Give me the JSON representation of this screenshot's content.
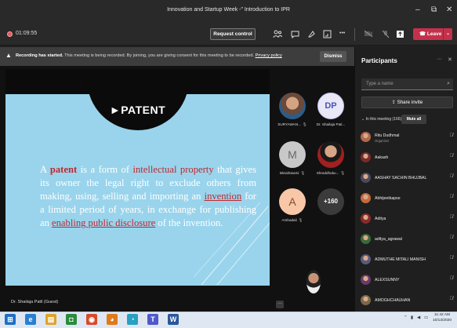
{
  "window": {
    "title": "Innovation and Startup Week -\" Introduction to IPR",
    "minimize_glyph": "–",
    "maximize_glyph": "⧉",
    "close_glyph": "✕"
  },
  "toolbar": {
    "timer": "01:09:55",
    "request_control_label": "Request control",
    "more_glyph": "•••",
    "leave_label": "Leave",
    "icons": [
      "people-icon",
      "chat-icon",
      "reactions-icon",
      "rooms-icon",
      "more-icon",
      "camera-icon",
      "mic-icon",
      "share-icon"
    ]
  },
  "banner": {
    "bold": "Recording has started.",
    "text": " This meeting is being recorded. By joining, you are giving consent for this meeting to be recorded.",
    "link": "Privacy policy",
    "dismiss_label": "Dismiss"
  },
  "slide": {
    "heading": "►PATENT",
    "body": {
      "p1": "A ",
      "patent": "patent",
      "p2": " is a form of ",
      "ip": "intellectual property",
      "p3": " that gives its owner the legal right to exclude others from making, using, selling and importing an ",
      "invention": "invention",
      "p4": " for a limited period of years, in exchange for publishing an ",
      "enabling": "enabling public disclosure",
      "p5": " of the invention."
    }
  },
  "presenter_label": "Dr. Shailaja Patil (Guest)",
  "tiles": [
    {
      "name": "SURYAWAN...",
      "initials": ""
    },
    {
      "name": "Dr. Shailaja Pati...",
      "initials": "DP"
    },
    {
      "name": "MinalSwami",
      "initials": "M"
    },
    {
      "name": "Shraddhaku...",
      "initials": ""
    },
    {
      "name": "Arshadali",
      "initials": "A"
    },
    {
      "name": "",
      "initials": "+160"
    }
  ],
  "panel": {
    "title": "Participants",
    "search_placeholder": "Type a name",
    "share_invite_label": "Share invite",
    "in_meeting_label": "In this meeting (166)",
    "mute_all_label": "Mute all",
    "people": [
      {
        "name": "Ritu Dudhmal",
        "sub": "Organizer",
        "color": "#b06a4a"
      },
      {
        "name": "Aakash",
        "sub": "",
        "color": "#7a2a2a"
      },
      {
        "name": "AASHAY SACHIN BHUJBAL",
        "sub": "",
        "color": "#4a4a5a"
      },
      {
        "name": "Abhijeetkapse",
        "sub": "",
        "color": "#c46a3a"
      },
      {
        "name": "Aditya",
        "sub": "",
        "color": "#8a2a2a"
      },
      {
        "name": "aditya_agrawal",
        "sub": "",
        "color": "#3a6a3a"
      },
      {
        "name": "ADMUTHE MITALI MANISH",
        "sub": "",
        "color": "#5a5a7a"
      },
      {
        "name": "ALEXSUNNY",
        "sub": "",
        "color": "#6a3a6a"
      },
      {
        "name": "AMOGHCHAUHAN",
        "sub": "",
        "color": "#7a6a4a"
      }
    ]
  },
  "taskbar": {
    "icons": [
      {
        "name": "start-icon",
        "glyph": "⊞",
        "color": "#1e6fc4"
      },
      {
        "name": "ie-icon",
        "glyph": "e",
        "color": "#2a7fd0"
      },
      {
        "name": "folder-icon",
        "glyph": "▤",
        "color": "#e0a22a"
      },
      {
        "name": "store-icon",
        "glyph": "◘",
        "color": "#2b8a3e"
      },
      {
        "name": "chrome-icon",
        "glyph": "◉",
        "color": "#d84a2a"
      },
      {
        "name": "firefox-icon",
        "glyph": "◕",
        "color": "#e07a1a"
      },
      {
        "name": "edge-icon",
        "glyph": "◔",
        "color": "#2aa0c0"
      },
      {
        "name": "teams-icon",
        "glyph": "T",
        "color": "#5059c9"
      },
      {
        "name": "word-icon",
        "glyph": "W",
        "color": "#2b579a"
      }
    ],
    "time": "11:42 AM",
    "date": "10/13/2020"
  }
}
